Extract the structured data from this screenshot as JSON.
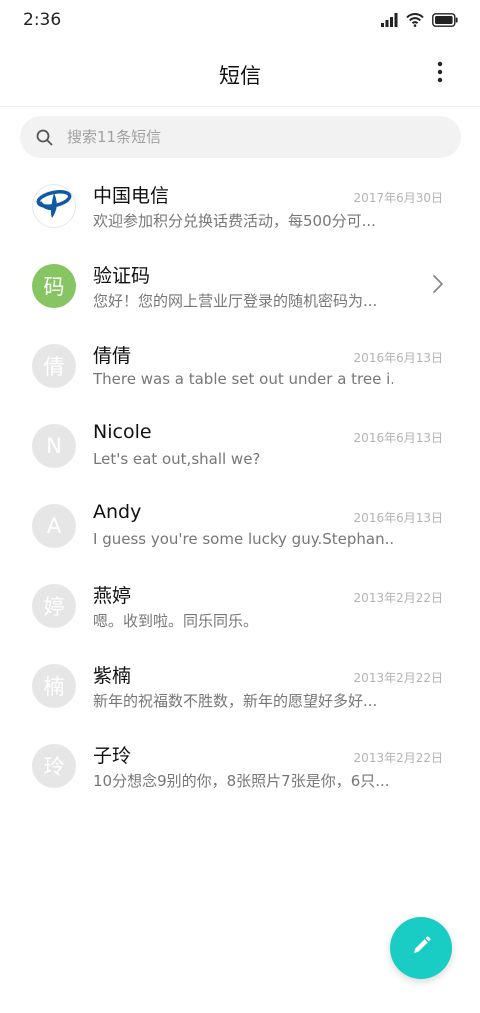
{
  "status_bar": {
    "time": "2:36",
    "icons": [
      "signal-icon",
      "wifi-icon",
      "battery-icon"
    ]
  },
  "header": {
    "title": "短信",
    "more_icon": "more-vertical-icon"
  },
  "search": {
    "placeholder": "搜索11条短信",
    "icon": "search-icon"
  },
  "conversations": [
    {
      "name": "中国电信",
      "date": "2017年6月30日",
      "preview": "欢迎参加积分兑换话费活动，每500分可...",
      "avatar_type": "logo",
      "avatar_text": ""
    },
    {
      "name": "验证码",
      "date": "",
      "preview": "您好！您的网上营业厅登录的随机密码为...",
      "avatar_type": "green",
      "avatar_text": "码"
    },
    {
      "name": "倩倩",
      "date": "2016年6月13日",
      "preview": "There was a table set out under a tree i...",
      "avatar_type": "gray",
      "avatar_text": "倩"
    },
    {
      "name": "Nicole",
      "date": "2016年6月13日",
      "preview": "Let's eat out,shall we?",
      "avatar_type": "gray",
      "avatar_text": "N"
    },
    {
      "name": "Andy",
      "date": "2016年6月13日",
      "preview": "I guess you're some lucky guy.Stephan...",
      "avatar_type": "gray",
      "avatar_text": "A"
    },
    {
      "name": "燕婷",
      "date": "2013年2月22日",
      "preview": "嗯。收到啦。同乐同乐。",
      "avatar_type": "gray",
      "avatar_text": "婷"
    },
    {
      "name": "紫楠",
      "date": "2013年2月22日",
      "preview": "新年的祝福数不胜数，新年的愿望好多好...",
      "avatar_type": "gray",
      "avatar_text": "楠"
    },
    {
      "name": "子玲",
      "date": "2013年2月22日",
      "preview": "10分想念9别的你，8张照片7张是你，6只...",
      "avatar_type": "gray",
      "avatar_text": "玲"
    }
  ],
  "colors": {
    "accent": "#19cdc4",
    "verification_avatar": "#86c562",
    "default_avatar": "#e6e6e6",
    "telecom_blue": "#0e5aa7"
  },
  "fab": {
    "icon": "pencil-icon"
  }
}
